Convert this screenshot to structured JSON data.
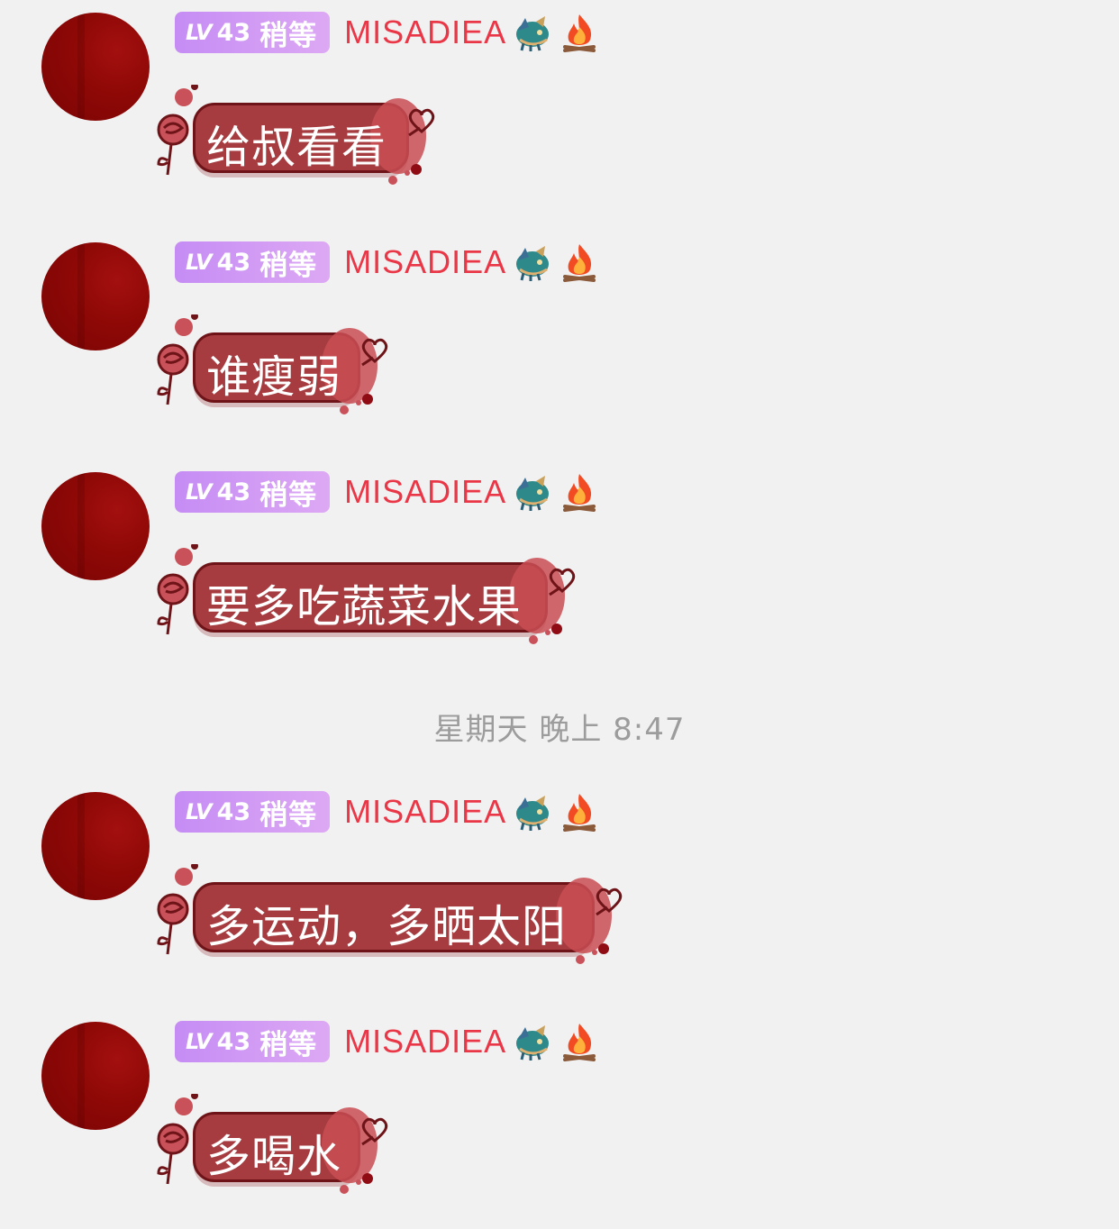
{
  "messages": [
    {
      "badge_level": "LV",
      "badge_number": "43",
      "badge_text": "稍等",
      "nickname": "MISADIEA",
      "text": "给叔看看",
      "icons": [
        "dragon-icon",
        "fire-icon"
      ]
    },
    {
      "badge_level": "LV",
      "badge_number": "43",
      "badge_text": "稍等",
      "nickname": "MISADIEA",
      "text": "谁瘦弱",
      "icons": [
        "dragon-icon",
        "fire-icon"
      ]
    },
    {
      "badge_level": "LV",
      "badge_number": "43",
      "badge_text": "稍等",
      "nickname": "MISADIEA",
      "text": "要多吃蔬菜水果",
      "icons": [
        "dragon-icon",
        "fire-icon"
      ]
    },
    {
      "badge_level": "LV",
      "badge_number": "43",
      "badge_text": "稍等",
      "nickname": "MISADIEA",
      "text": "多运动，多晒太阳",
      "icons": [
        "dragon-icon",
        "fire-icon"
      ]
    },
    {
      "badge_level": "LV",
      "badge_number": "43",
      "badge_text": "稍等",
      "nickname": "MISADIEA",
      "text": "多喝水",
      "icons": [
        "dragon-icon",
        "fire-icon"
      ]
    }
  ],
  "timestamp": "星期天 晚上 8:47",
  "colors": {
    "background": "#f2f1f1",
    "nickname": "#e93747",
    "bubble": "#a63c40",
    "avatar": "#8d0806",
    "badge": "#c58cf4"
  }
}
